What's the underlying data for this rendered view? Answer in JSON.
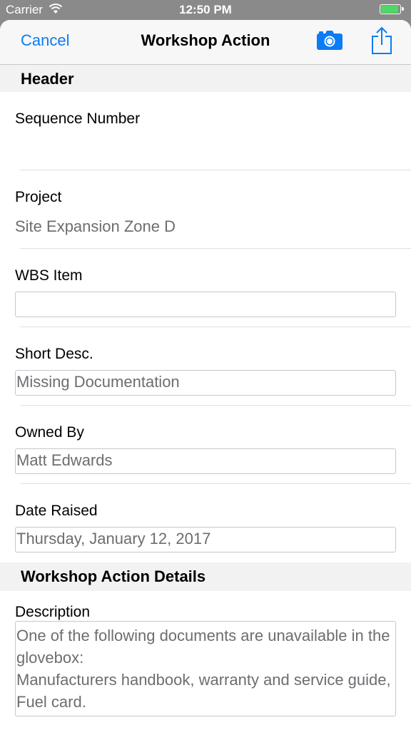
{
  "status_bar": {
    "carrier": "Carrier",
    "time": "12:50 PM",
    "battery_level": 0.95,
    "battery_color": "#4cd964"
  },
  "nav": {
    "cancel_label": "Cancel",
    "title": "Workshop Action",
    "camera_icon": "camera-icon",
    "share_icon": "share-icon",
    "accent_color": "#0a7cf5"
  },
  "sections": {
    "header": "Header",
    "details": "Workshop Action Details"
  },
  "fields": {
    "sequence_number": {
      "label": "Sequence Number",
      "value": ""
    },
    "project": {
      "label": "Project",
      "value": "Site Expansion Zone D"
    },
    "wbs_item": {
      "label": "WBS Item",
      "value": ""
    },
    "short_desc": {
      "label": "Short Desc.",
      "value": "Missing Documentation"
    },
    "owned_by": {
      "label": "Owned By",
      "value": "Matt Edwards"
    },
    "date_raised": {
      "label": "Date Raised",
      "value": "Thursday, January 12, 2017"
    },
    "description": {
      "label": "Description",
      "value": "One of the following documents are unavailable in the glovebox:\nManufacturers handbook, warranty and service guide, Fuel card."
    }
  }
}
